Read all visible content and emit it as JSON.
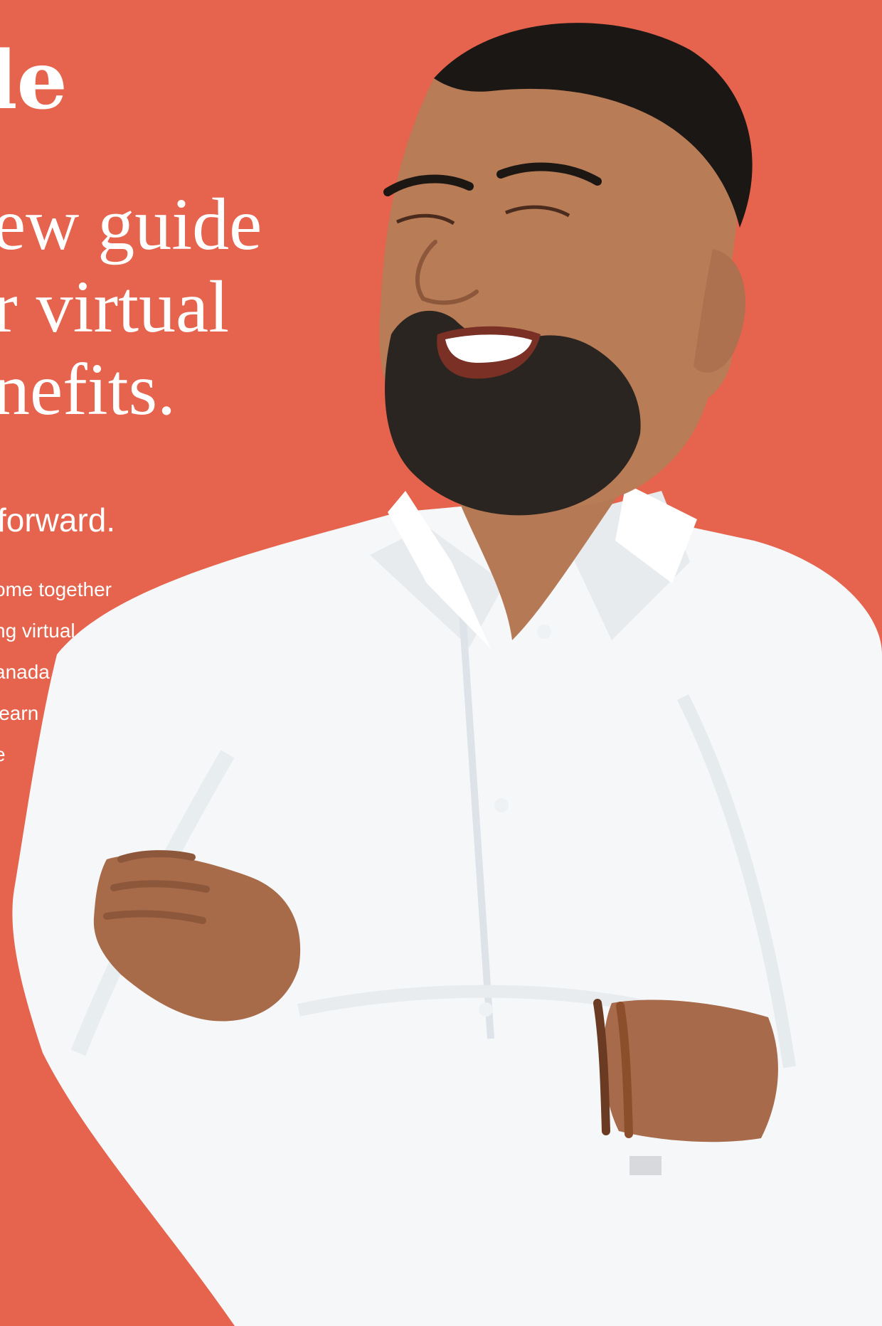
{
  "hero": {
    "brand_fragment": "le",
    "headline_lines": [
      "ew guide",
      "r virtual",
      "nefits."
    ],
    "subhead": " forward.",
    "body_lines": [
      "ome together",
      "ng virtual",
      "anada.",
      "learn",
      "e"
    ]
  },
  "image": {
    "subject": "smiling-man-white-shirt-arms-crossed"
  },
  "colors": {
    "background": "#e6634d",
    "text": "#ffffff",
    "shirt": "#f4f6f7",
    "skin": "#b77a55"
  }
}
